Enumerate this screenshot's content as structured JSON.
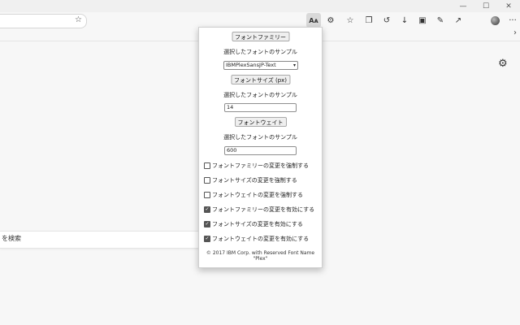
{
  "toolbar": {
    "font_button_label": "Aᴀ",
    "more_label": "···"
  },
  "search": {
    "text": "を検索"
  },
  "popup": {
    "font_family_button": "フォントファミリー",
    "sample_1": "選択したフォントのサンプル",
    "font_select_value": "IBMPlexSansJP-Text",
    "font_size_button": "フォントサイズ (px)",
    "sample_2": "選択したフォントのサンプル",
    "font_size_value": "14",
    "font_weight_button": "フォントウェイト",
    "sample_3": "選択したフォントのサンプル",
    "font_weight_value": "600",
    "checkboxes": [
      {
        "label": "フォントファミリーの変更を強制する",
        "checked": false
      },
      {
        "label": "フォントサイズの変更を強制する",
        "checked": false
      },
      {
        "label": "フォントウェイトの変更を強制する",
        "checked": false
      },
      {
        "label": "フォントファミリーの変更を有効にする",
        "checked": true
      },
      {
        "label": "フォントサイズの変更を有効にする",
        "checked": true
      },
      {
        "label": "フォントウェイトの変更を有効にする",
        "checked": true
      }
    ],
    "copyright": "© 2017 IBM Corp. with Reserved Font Name \"Plex\""
  }
}
